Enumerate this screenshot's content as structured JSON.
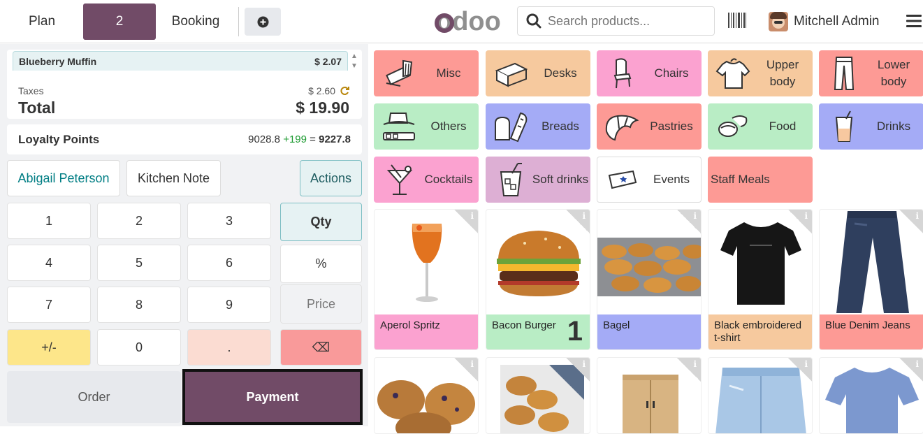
{
  "topbar": {
    "plan_label": "Plan",
    "table_label": "2",
    "booking_label": "Booking",
    "logo_text": "odoo",
    "search_placeholder": "Search products...",
    "user_name": "Mitchell Admin"
  },
  "order": {
    "line_name": "Blueberry Muffin",
    "line_price": "$ 2.07",
    "taxes_label": "Taxes",
    "taxes_value": "$ 2.60",
    "total_label": "Total",
    "total_value": "$ 19.90"
  },
  "loyalty": {
    "label": "Loyalty Points",
    "current": "9028.8",
    "added": "+199",
    "equals": "=",
    "new_total": "9227.8"
  },
  "controls": {
    "customer": "Abigail Peterson",
    "kitchen_note": "Kitchen Note",
    "actions": "Actions"
  },
  "numpad": {
    "k1": "1",
    "k2": "2",
    "k3": "3",
    "qty": "Qty",
    "k4": "4",
    "k5": "5",
    "k6": "6",
    "pct": "%",
    "k7": "7",
    "k8": "8",
    "k9": "9",
    "price": "Price",
    "pm": "+/-",
    "k0": "0",
    "dot": ".",
    "back": "⌫"
  },
  "buttons": {
    "order": "Order",
    "payment": "Payment"
  },
  "categories": [
    {
      "label": "Misc",
      "color": "#fd9a95",
      "icon": "misc-icon"
    },
    {
      "label": "Desks",
      "color": "#f6c99e",
      "icon": "desk-icon"
    },
    {
      "label": "Chairs",
      "color": "#fba2d0",
      "icon": "chair-icon"
    },
    {
      "label": "Upper body",
      "color": "#f6c99e",
      "icon": "tshirt-icon"
    },
    {
      "label": "Lower body",
      "color": "#fd9a95",
      "icon": "trousers-icon"
    },
    {
      "label": "Others",
      "color": "#b9edc5",
      "icon": "hat-icon"
    },
    {
      "label": "Breads",
      "color": "#a4abf6",
      "icon": "bread-icon"
    },
    {
      "label": "Pastries",
      "color": "#fd9a95",
      "icon": "croissant-icon"
    },
    {
      "label": "Food",
      "color": "#b9edc5",
      "icon": "food-icon"
    },
    {
      "label": "Drinks",
      "color": "#a4abf6",
      "icon": "drink-icon"
    },
    {
      "label": "Cocktails",
      "color": "#fba2d0",
      "icon": "cocktail-icon"
    },
    {
      "label": "Soft drinks",
      "color": "#ddafd4",
      "icon": "soft-drink-icon"
    },
    {
      "label": "Events",
      "color": "#ffffff",
      "icon": "ticket-icon"
    },
    {
      "label": "Staff Meals",
      "color": "#fd9a95",
      "icon": ""
    }
  ],
  "products": [
    {
      "name": "Aperol Spritz",
      "color": "#fba2d0",
      "qty": ""
    },
    {
      "name": "Bacon Burger",
      "color": "#b9edc5",
      "qty": "1"
    },
    {
      "name": "Bagel",
      "color": "#a4abf6",
      "qty": ""
    },
    {
      "name": "Black embroidered t-shirt",
      "color": "#f6c99e",
      "qty": ""
    },
    {
      "name": "Blue Denim Jeans",
      "color": "#fd9a95",
      "qty": ""
    }
  ],
  "info_glyph": "i",
  "colors": {
    "brand": "#714b67",
    "accent": "#017e84"
  }
}
